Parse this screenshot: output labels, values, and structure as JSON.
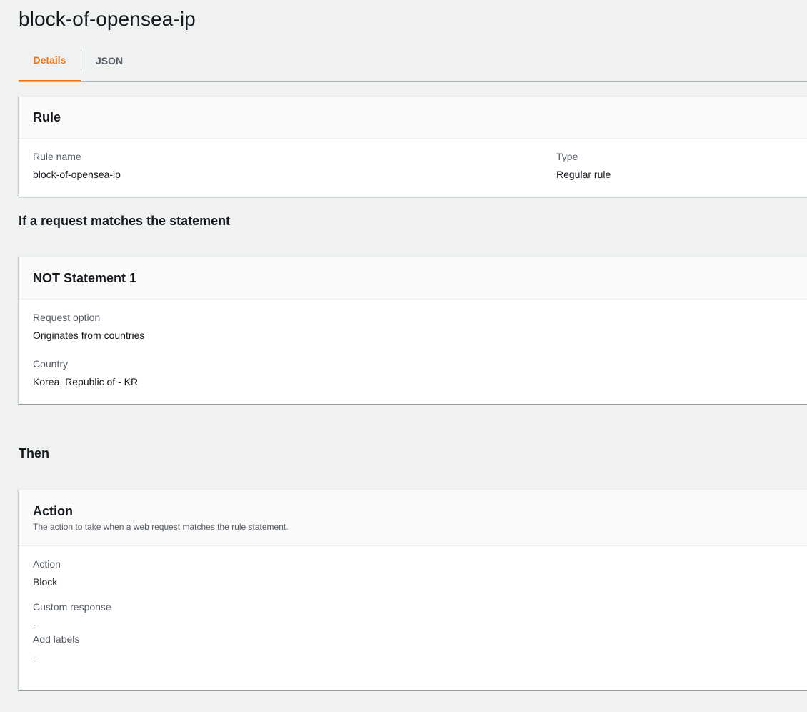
{
  "page": {
    "title": "block-of-opensea-ip"
  },
  "tabs": [
    {
      "label": "Details",
      "active": true
    },
    {
      "label": "JSON",
      "active": false
    }
  ],
  "rule_card": {
    "title": "Rule",
    "fields": {
      "rule_name": {
        "label": "Rule name",
        "value": "block-of-opensea-ip"
      },
      "type": {
        "label": "Type",
        "value": "Regular rule"
      }
    }
  },
  "statement_heading": "If a request matches the statement",
  "statement_card": {
    "title": "NOT Statement 1",
    "fields": {
      "request_option": {
        "label": "Request option",
        "value": "Originates from countries"
      },
      "country": {
        "label": "Country",
        "value": "Korea, Republic of - KR"
      }
    }
  },
  "then_heading": "Then",
  "action_card": {
    "title": "Action",
    "description": "The action to take when a web request matches the rule statement.",
    "fields": {
      "action": {
        "label": "Action",
        "value": "Block"
      },
      "custom_response": {
        "label": "Custom response",
        "value": "-"
      },
      "add_labels": {
        "label": "Add labels",
        "value": "-"
      }
    }
  },
  "colors": {
    "accent": "#ec7211",
    "background": "#f0f1f1",
    "text": "#16191f",
    "muted": "#545b64"
  }
}
